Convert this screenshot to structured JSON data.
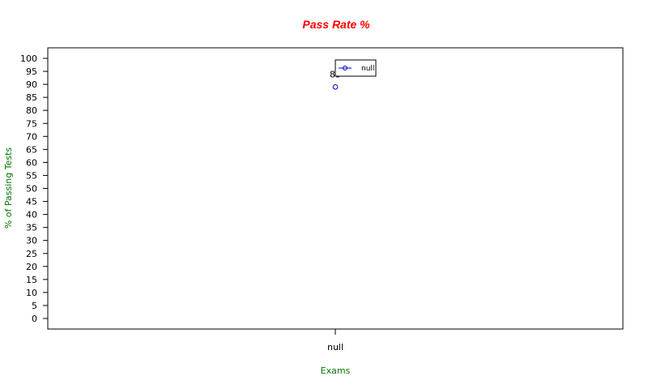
{
  "chart_data": {
    "type": "scatter",
    "title": "Pass Rate %",
    "xlabel": "Exams",
    "ylabel": "% of Passing Tests",
    "categories": [
      "null"
    ],
    "series": [
      {
        "name": "null",
        "values": [
          89
        ],
        "color": "#0000cc"
      }
    ],
    "data_labels": [
      "89"
    ],
    "ylim": [
      0,
      100
    ],
    "yticks": [
      0,
      5,
      10,
      15,
      20,
      25,
      30,
      35,
      40,
      45,
      50,
      55,
      60,
      65,
      70,
      75,
      80,
      85,
      90,
      95,
      100
    ],
    "grid": false,
    "legend_position": "top",
    "colors": {
      "title": "#ff0000",
      "axis_title": "#007700",
      "axis": "#000000"
    }
  }
}
